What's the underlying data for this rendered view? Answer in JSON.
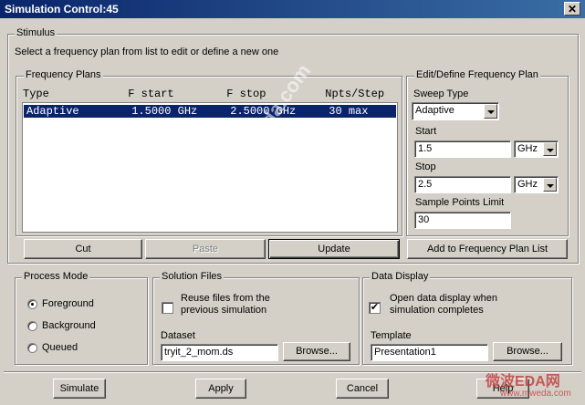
{
  "window": {
    "title": "Simulation Control:45",
    "close_glyph": "✕"
  },
  "stimulus": {
    "legend": "Stimulus",
    "instruction": "Select a frequency plan from list to edit or define a new one",
    "freq_plans": {
      "legend": "Frequency Plans",
      "header": "Type            F start        F stop         Npts/Step",
      "rows": [
        {
          "text": "Adaptive        1.5000 GHz     2.5000 GHz     30 max"
        }
      ]
    },
    "edit": {
      "legend": "Edit/Define Frequency Plan",
      "sweep_type_label": "Sweep Type",
      "sweep_type_value": "Adaptive",
      "start_label": "Start",
      "start_value": "1.5",
      "start_unit": "GHz",
      "stop_label": "Stop",
      "stop_value": "2.5",
      "stop_unit": "GHz",
      "sample_label": "Sample Points Limit",
      "sample_value": "30"
    },
    "buttons": {
      "cut": "Cut",
      "paste": "Paste",
      "update": "Update",
      "add": "Add to Frequency Plan List"
    }
  },
  "process_mode": {
    "legend": "Process Mode",
    "options": [
      {
        "label": "Foreground",
        "selected": true
      },
      {
        "label": "Background",
        "selected": false
      },
      {
        "label": "Queued",
        "selected": false
      }
    ]
  },
  "solution_files": {
    "legend": "Solution Files",
    "reuse_line1": "Reuse files from the",
    "reuse_line2": "previous simulation",
    "reuse_checked": false,
    "dataset_label": "Dataset",
    "dataset_value": "tryit_2_mom.ds",
    "browse": "Browse..."
  },
  "data_display": {
    "legend": "Data Display",
    "open_line1": "Open data display when",
    "open_line2": "simulation completes",
    "open_checked": true,
    "check_glyph": "✔",
    "template_label": "Template",
    "template_value": "Presentation1",
    "browse": "Browse..."
  },
  "footer": {
    "simulate": "Simulate",
    "apply": "Apply",
    "cancel": "Cancel",
    "help": "Help"
  },
  "watermarks": {
    "diagonal": "www.mweda.com",
    "logo": "微波EDA网",
    "url": "www.mweda.com"
  }
}
